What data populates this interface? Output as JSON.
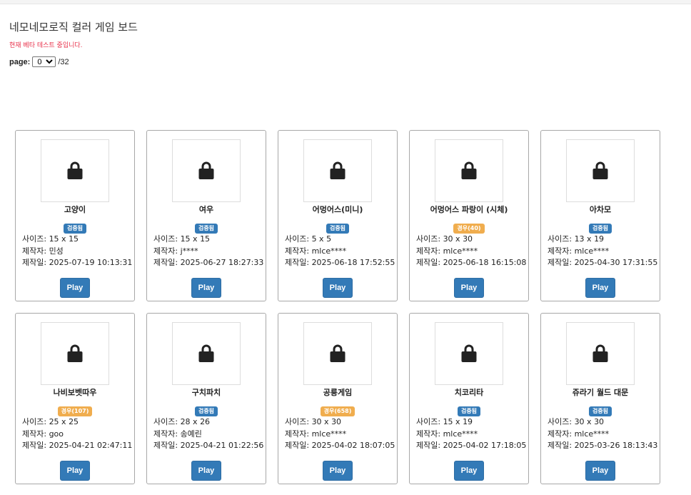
{
  "page_title": "네모네모로직 컬러 게임 보드",
  "notice": "현재 베타 테스트 중입니다.",
  "pager": {
    "label": "page:",
    "current": "0",
    "total_text": "/32"
  },
  "labels": {
    "size": "사이즈: ",
    "maker": "제작자: ",
    "date": "제작일: ",
    "play": "Play"
  },
  "colors": {
    "badge_verified": "#337ab7",
    "badge_warn": "#f0ad4e",
    "play_button": "#337ab7",
    "notice": "#e8304a"
  },
  "icons": {
    "thumbnail": "lock-icon"
  },
  "games": [
    {
      "title": "고양이",
      "badge": "검증됨",
      "badge_type": "verified",
      "size": "15 x 15",
      "maker": "민성",
      "date": "2025-07-19 10:13:31"
    },
    {
      "title": "여우",
      "badge": "검증됨",
      "badge_type": "verified",
      "size": "15 x 15",
      "maker": "j****",
      "date": "2025-06-27 18:27:33"
    },
    {
      "title": "어멍어스(미니)",
      "badge": "검증됨",
      "badge_type": "verified",
      "size": "5 x 5",
      "maker": "mlce****",
      "date": "2025-06-18 17:52:55"
    },
    {
      "title": "어멍어스 파랑이 (시체)",
      "badge": "경우(40)",
      "badge_type": "warn",
      "size": "30 x 30",
      "maker": "mlce****",
      "date": "2025-06-18 16:15:08"
    },
    {
      "title": "아차모",
      "badge": "검증됨",
      "badge_type": "verified",
      "size": "13 x 19",
      "maker": "mlce****",
      "date": "2025-04-30 17:31:55"
    },
    {
      "title": "나비보벳따우",
      "badge": "경우(107)",
      "badge_type": "warn",
      "size": "25 x 25",
      "maker": "goo",
      "date": "2025-04-21 02:47:11"
    },
    {
      "title": "구치파치",
      "badge": "검증됨",
      "badge_type": "verified",
      "size": "28 x 26",
      "maker": "송예린",
      "date": "2025-04-21 01:22:56"
    },
    {
      "title": "공룡게임",
      "badge": "경우(658)",
      "badge_type": "warn",
      "size": "30 x 30",
      "maker": "mlce****",
      "date": "2025-04-02 18:07:05"
    },
    {
      "title": "치코리타",
      "badge": "검증됨",
      "badge_type": "verified",
      "size": "15 x 19",
      "maker": "mlce****",
      "date": "2025-04-02 17:18:05"
    },
    {
      "title": "쥬라기 월드 대문",
      "badge": "검증됨",
      "badge_type": "verified",
      "size": "30 x 30",
      "maker": "mlce****",
      "date": "2025-03-26 18:13:43"
    }
  ]
}
